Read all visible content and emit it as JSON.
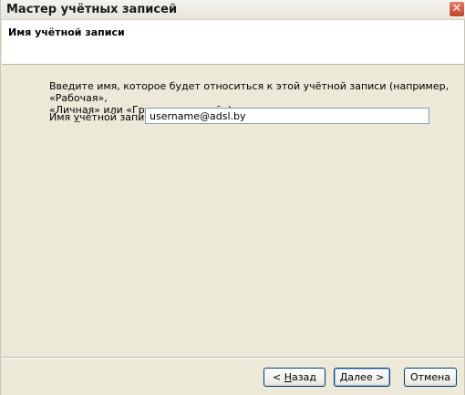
{
  "window": {
    "title": "Мастер учётных записей",
    "close_glyph": "✕"
  },
  "header": {
    "page_title": "Имя учётной записи"
  },
  "main": {
    "description_line1": "Введите имя, которое будет относиться к этой учётной записи (например, «Рабочая»,",
    "description_line2": "«Личная» или «Группа новостей»).",
    "field_label_pre": "Имя ",
    "field_label_accel": "у",
    "field_label_post": "чётной записи:",
    "field_value": "username@adsl.by"
  },
  "buttons": {
    "back_pre": "< ",
    "back_accel": "Н",
    "back_post": "азад",
    "next_accel": "Д",
    "next_post": "алее >",
    "cancel": "Отмена"
  },
  "colors": {
    "dialog_bg": "#ece9d8",
    "header_bg": "#ffffff",
    "close_button": "#c4432b",
    "input_border": "#7f9db9",
    "button_border": "#003c74"
  }
}
